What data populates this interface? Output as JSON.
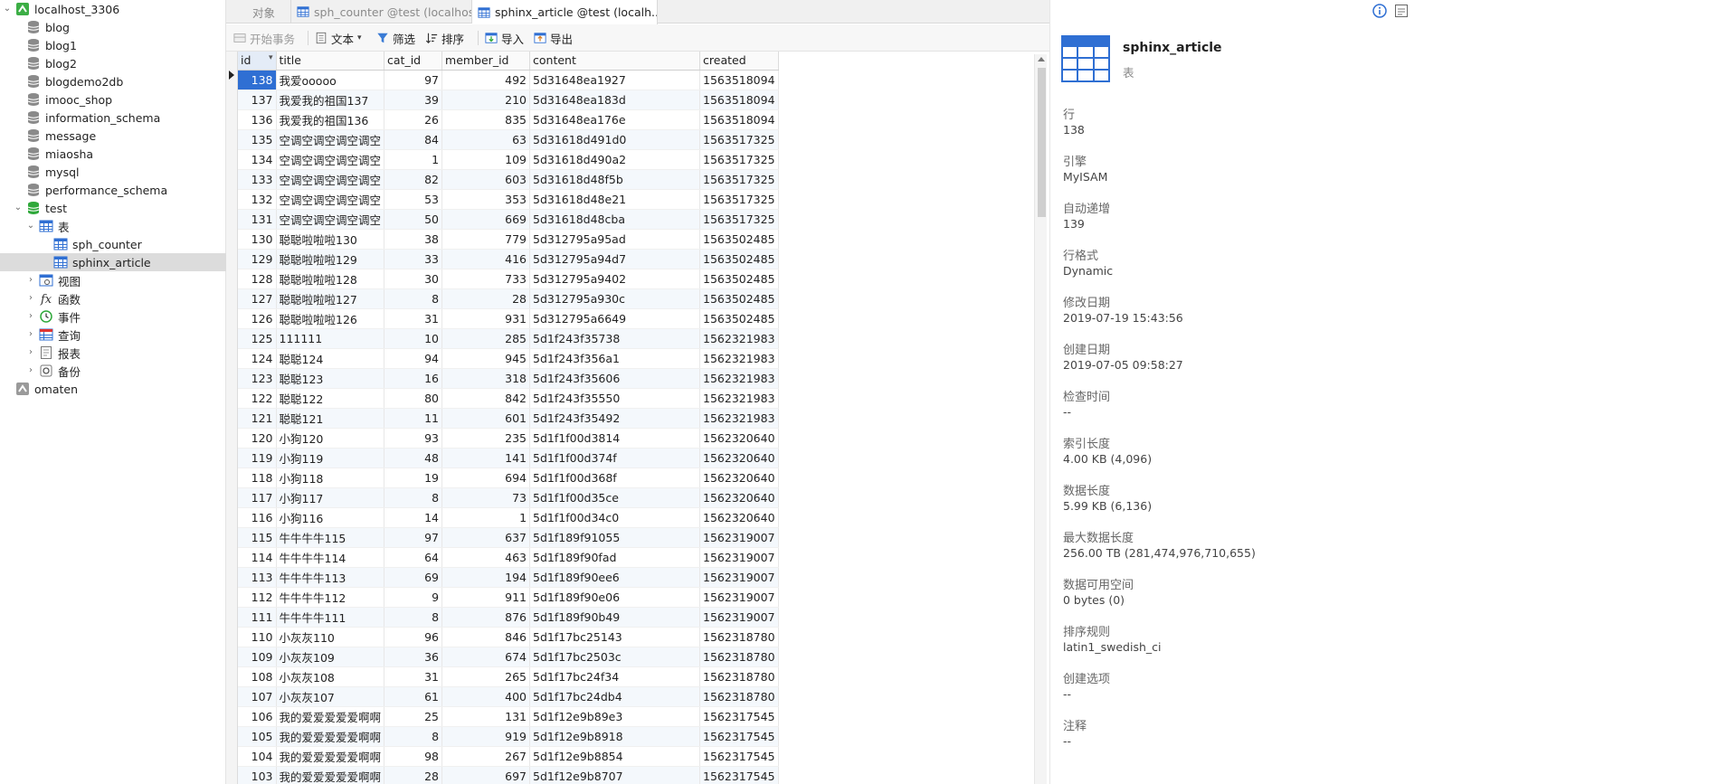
{
  "sidebar": {
    "connection": "localhost_3306",
    "databases": [
      "blog",
      "blog1",
      "blog2",
      "blogdemo2db",
      "imooc_shop",
      "information_schema",
      "message",
      "miaosha",
      "mysql",
      "performance_schema"
    ],
    "open_db": "test",
    "tables_group": "表",
    "tables": [
      "sph_counter",
      "sphinx_article"
    ],
    "selected_table": "sphinx_article",
    "groups": [
      "视图",
      "函数",
      "事件",
      "查询",
      "报表",
      "备份"
    ],
    "other_connection": "omaten"
  },
  "tabs": [
    {
      "label": "对象",
      "active": false
    },
    {
      "label": "sph_counter @test (localhos...",
      "active": false
    },
    {
      "label": "sphinx_article @test (localh...",
      "active": true
    }
  ],
  "toolbar": {
    "begin_tx": "开始事务",
    "text": "文本",
    "filter": "筛选",
    "sort": "排序",
    "import": "导入",
    "export": "导出"
  },
  "grid": {
    "columns": [
      "id",
      "title",
      "cat_id",
      "member_id",
      "content",
      "created"
    ],
    "rows": [
      [
        "138",
        "我爱ooooo",
        "97",
        "492",
        "5d31648ea1927",
        "1563518094"
      ],
      [
        "137",
        "我爱我的祖国137",
        "39",
        "210",
        "5d31648ea183d",
        "1563518094"
      ],
      [
        "136",
        "我爱我的祖国136",
        "26",
        "835",
        "5d31648ea176e",
        "1563518094"
      ],
      [
        "135",
        "空调空调空调空调空",
        "84",
        "63",
        "5d31618d491d0",
        "1563517325"
      ],
      [
        "134",
        "空调空调空调空调空",
        "1",
        "109",
        "5d31618d490a2",
        "1563517325"
      ],
      [
        "133",
        "空调空调空调空调空",
        "82",
        "603",
        "5d31618d48f5b",
        "1563517325"
      ],
      [
        "132",
        "空调空调空调空调空",
        "53",
        "353",
        "5d31618d48e21",
        "1563517325"
      ],
      [
        "131",
        "空调空调空调空调空",
        "50",
        "669",
        "5d31618d48cba",
        "1563517325"
      ],
      [
        "130",
        "聪聪啦啦啦130",
        "38",
        "779",
        "5d312795a95ad",
        "1563502485"
      ],
      [
        "129",
        "聪聪啦啦啦129",
        "33",
        "416",
        "5d312795a94d7",
        "1563502485"
      ],
      [
        "128",
        "聪聪啦啦啦128",
        "30",
        "733",
        "5d312795a9402",
        "1563502485"
      ],
      [
        "127",
        "聪聪啦啦啦127",
        "8",
        "28",
        "5d312795a930c",
        "1563502485"
      ],
      [
        "126",
        "聪聪啦啦啦126",
        "31",
        "931",
        "5d312795a6649",
        "1563502485"
      ],
      [
        "125",
        "111111",
        "10",
        "285",
        "5d1f243f35738",
        "1562321983"
      ],
      [
        "124",
        "聪聪124",
        "94",
        "945",
        "5d1f243f356a1",
        "1562321983"
      ],
      [
        "123",
        "聪聪123",
        "16",
        "318",
        "5d1f243f35606",
        "1562321983"
      ],
      [
        "122",
        "聪聪122",
        "80",
        "842",
        "5d1f243f35550",
        "1562321983"
      ],
      [
        "121",
        "聪聪121",
        "11",
        "601",
        "5d1f243f35492",
        "1562321983"
      ],
      [
        "120",
        "小狗120",
        "93",
        "235",
        "5d1f1f00d3814",
        "1562320640"
      ],
      [
        "119",
        "小狗119",
        "48",
        "141",
        "5d1f1f00d374f",
        "1562320640"
      ],
      [
        "118",
        "小狗118",
        "19",
        "694",
        "5d1f1f00d368f",
        "1562320640"
      ],
      [
        "117",
        "小狗117",
        "8",
        "73",
        "5d1f1f00d35ce",
        "1562320640"
      ],
      [
        "116",
        "小狗116",
        "14",
        "1",
        "5d1f1f00d34c0",
        "1562320640"
      ],
      [
        "115",
        "牛牛牛牛115",
        "97",
        "637",
        "5d1f189f91055",
        "1562319007"
      ],
      [
        "114",
        "牛牛牛牛114",
        "64",
        "463",
        "5d1f189f90fad",
        "1562319007"
      ],
      [
        "113",
        "牛牛牛牛113",
        "69",
        "194",
        "5d1f189f90ee6",
        "1562319007"
      ],
      [
        "112",
        "牛牛牛牛112",
        "9",
        "911",
        "5d1f189f90e06",
        "1562319007"
      ],
      [
        "111",
        "牛牛牛牛111",
        "8",
        "876",
        "5d1f189f90b49",
        "1562319007"
      ],
      [
        "110",
        "小灰灰110",
        "96",
        "846",
        "5d1f17bc25143",
        "1562318780"
      ],
      [
        "109",
        "小灰灰109",
        "36",
        "674",
        "5d1f17bc2503c",
        "1562318780"
      ],
      [
        "108",
        "小灰灰108",
        "31",
        "265",
        "5d1f17bc24f34",
        "1562318780"
      ],
      [
        "107",
        "小灰灰107",
        "61",
        "400",
        "5d1f17bc24db4",
        "1562318780"
      ],
      [
        "106",
        "我的爱爱爱爱爱啊啊",
        "25",
        "131",
        "5d1f12e9b89e3",
        "1562317545"
      ],
      [
        "105",
        "我的爱爱爱爱爱啊啊",
        "8",
        "919",
        "5d1f12e9b8918",
        "1562317545"
      ],
      [
        "104",
        "我的爱爱爱爱爱啊啊",
        "98",
        "267",
        "5d1f12e9b8854",
        "1562317545"
      ],
      [
        "103",
        "我的爱爱爱爱爱啊啊",
        "28",
        "697",
        "5d1f12e9b8707",
        "1562317545"
      ]
    ]
  },
  "info": {
    "name": "sphinx_article",
    "type": "表",
    "props": [
      {
        "label": "行",
        "value": "138"
      },
      {
        "label": "引擎",
        "value": "MyISAM"
      },
      {
        "label": "自动递增",
        "value": "139"
      },
      {
        "label": "行格式",
        "value": "Dynamic"
      },
      {
        "label": "修改日期",
        "value": "2019-07-19 15:43:56"
      },
      {
        "label": "创建日期",
        "value": "2019-07-05 09:58:27"
      },
      {
        "label": "检查时间",
        "value": "--"
      },
      {
        "label": "索引长度",
        "value": "4.00 KB (4,096)"
      },
      {
        "label": "数据长度",
        "value": "5.99 KB (6,136)"
      },
      {
        "label": "最大数据长度",
        "value": "256.00 TB (281,474,976,710,655)"
      },
      {
        "label": "数据可用空间",
        "value": "0 bytes (0)"
      },
      {
        "label": "排序规则",
        "value": "latin1_swedish_ci"
      },
      {
        "label": "创建选项",
        "value": "--"
      },
      {
        "label": "注释",
        "value": "--"
      }
    ]
  },
  "colors": {
    "selection": "#2f6fd3",
    "db_icon": "#8a8a8a",
    "open_db_icon": "#2fa83a",
    "table_icon": "#2f6fd3",
    "connection_icon": "#3cae45"
  }
}
